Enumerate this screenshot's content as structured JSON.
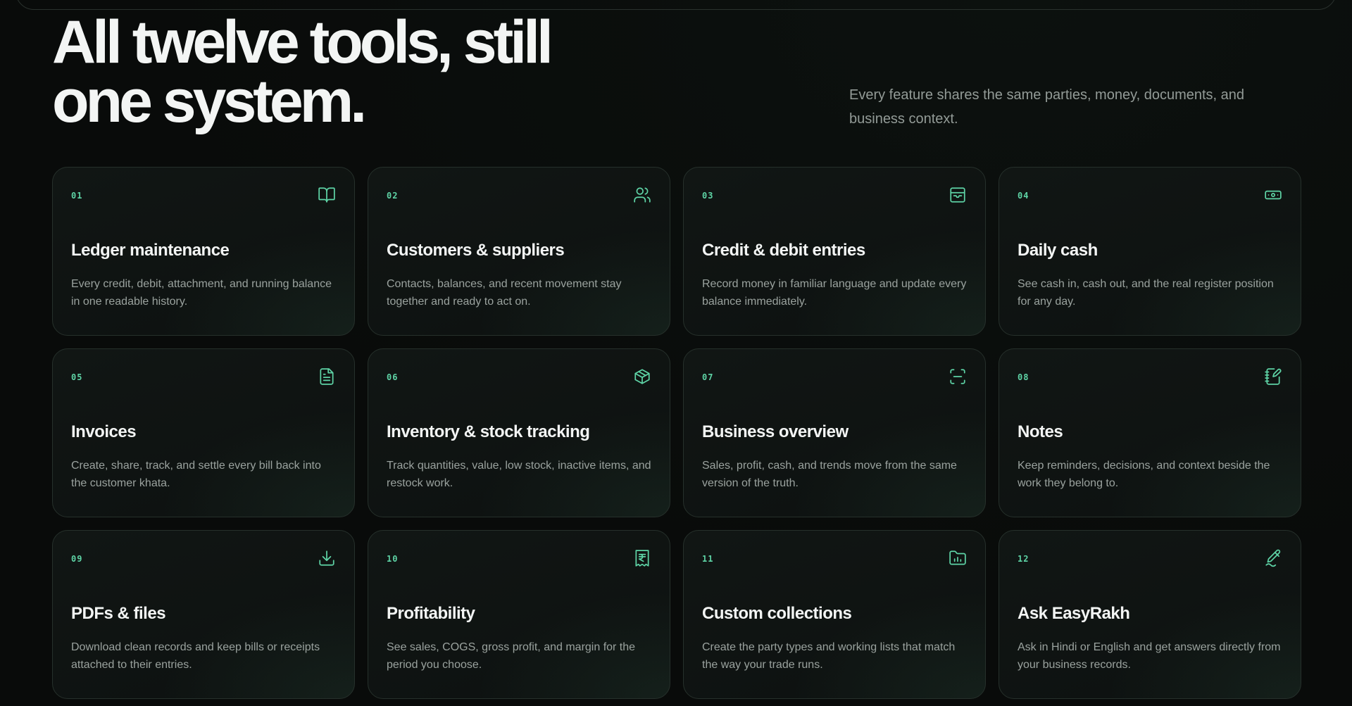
{
  "header": {
    "headline_line1": "All twelve tools, still",
    "headline_line2": "one system.",
    "subtext": "Every feature shares the same parties, money, documents, and business context."
  },
  "colors": {
    "accent": "#5ed4a6",
    "background": "#090b0a",
    "card_background": "#111614",
    "card_border": "#26302b",
    "title_text": "#f3f5f4",
    "body_text": "#9aa29e"
  },
  "cards": [
    {
      "number": "01",
      "icon": "book-open-icon",
      "title": "Ledger maintenance",
      "description": "Every credit, debit, attachment, and running balance in one readable history."
    },
    {
      "number": "02",
      "icon": "users-icon",
      "title": "Customers & suppliers",
      "description": "Contacts, balances, and recent movement stay together and ready to act on."
    },
    {
      "number": "03",
      "icon": "inbox-icon",
      "title": "Credit & debit entries",
      "description": "Record money in familiar language and update every balance immediately."
    },
    {
      "number": "04",
      "icon": "banknote-icon",
      "title": "Daily cash",
      "description": "See cash in, cash out, and the real register position for any day."
    },
    {
      "number": "05",
      "icon": "file-text-icon",
      "title": "Invoices",
      "description": "Create, share, track, and settle every bill back into the customer khata."
    },
    {
      "number": "06",
      "icon": "box-icon",
      "title": "Inventory & stock tracking",
      "description": "Track quantities, value, low stock, inactive items, and restock work."
    },
    {
      "number": "07",
      "icon": "scan-icon",
      "title": "Business overview",
      "description": "Sales, profit, cash, and trends move from the same version of the truth."
    },
    {
      "number": "08",
      "icon": "notebook-pen-icon",
      "title": "Notes",
      "description": "Keep reminders, decisions, and context beside the work they belong to."
    },
    {
      "number": "09",
      "icon": "download-icon",
      "title": "PDFs & files",
      "description": "Download clean records and keep bills or receipts attached to their entries."
    },
    {
      "number": "10",
      "icon": "receipt-rupee-icon",
      "title": "Profitability",
      "description": "See sales, COGS, gross profit, and margin for the period you choose."
    },
    {
      "number": "11",
      "icon": "folder-chart-icon",
      "title": "Custom collections",
      "description": "Create the party types and working lists that match the way your trade runs."
    },
    {
      "number": "12",
      "icon": "sparkle-pen-icon",
      "title": "Ask EasyRakh",
      "description": "Ask in Hindi or English and get answers directly from your business records."
    }
  ]
}
